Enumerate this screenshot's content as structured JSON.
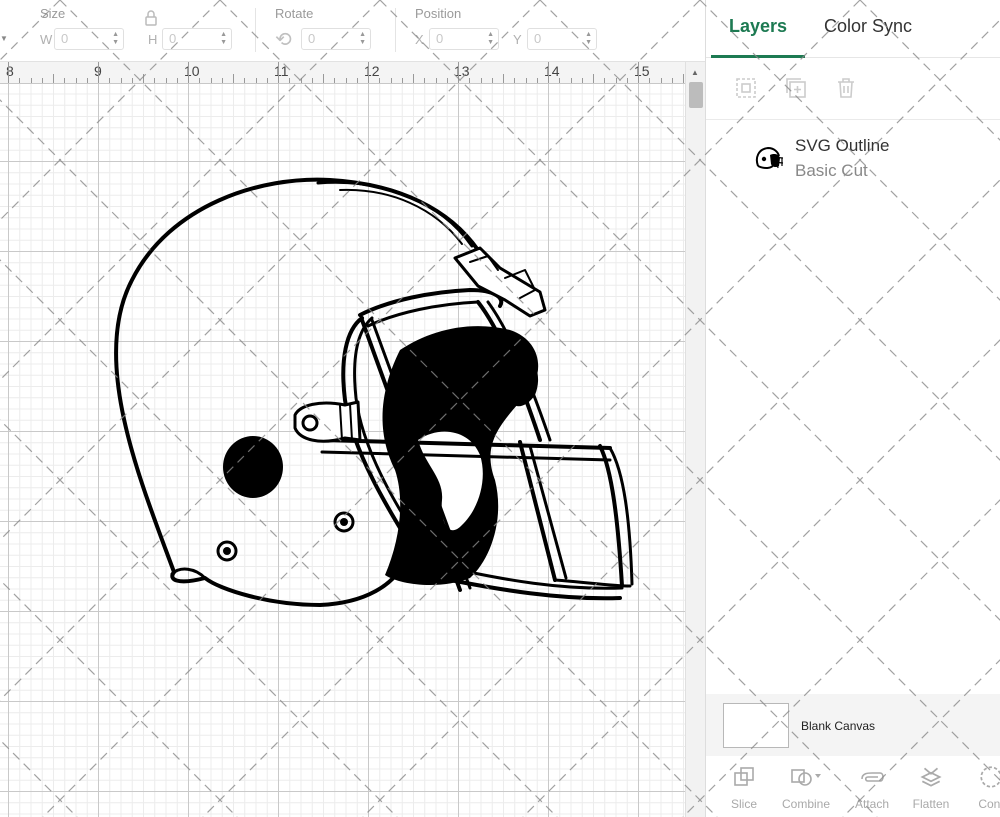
{
  "toolbar": {
    "size_label": "Size",
    "w_label": "W",
    "w_value": "0",
    "h_label": "H",
    "h_value": "0",
    "rotate_label": "Rotate",
    "rotate_value": "0",
    "position_label": "Position",
    "x_label": "X",
    "x_value": "0",
    "y_label": "Y",
    "y_value": "0"
  },
  "ruler": [
    "8",
    "9",
    "10",
    "11",
    "12",
    "13",
    "14",
    "15"
  ],
  "panel": {
    "tabs": [
      {
        "label": "Layers",
        "active": true
      },
      {
        "label": "Color Sync",
        "active": false
      }
    ],
    "layer": {
      "name": "SVG Outline",
      "operation": "Basic Cut"
    },
    "blank_canvas": "Blank Canvas",
    "actions": [
      {
        "label": "Slice",
        "icon": "slice-icon"
      },
      {
        "label": "Combine",
        "icon": "combine-icon"
      },
      {
        "label": "Attach",
        "icon": "attach-icon"
      },
      {
        "label": "Flatten",
        "icon": "flatten-icon"
      },
      {
        "label": "Cont",
        "icon": "contour-icon"
      }
    ]
  },
  "colors": {
    "accent": "#1d7a52",
    "grid_major": "#c9c9c9",
    "grid_minor": "#ececec"
  }
}
